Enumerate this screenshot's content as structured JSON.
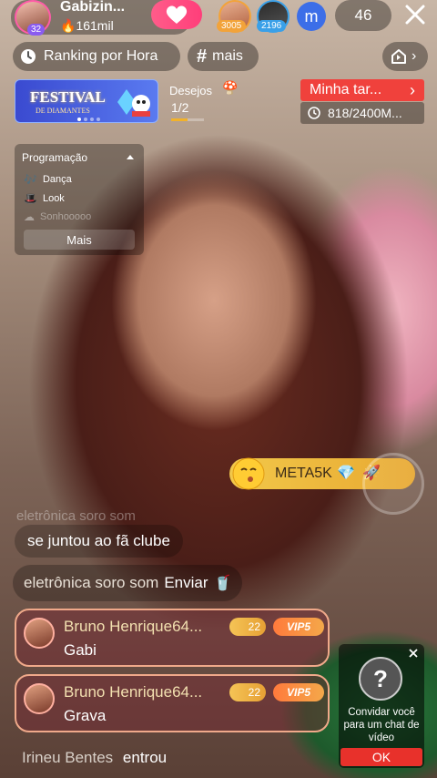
{
  "header": {
    "streamer_name": "Gabizin...",
    "level": "32",
    "likes": "161mil",
    "viewers": [
      {
        "score": "3005",
        "color": "#f2a33a"
      },
      {
        "score": "2196",
        "color": "#3aa0e8"
      },
      {
        "initial": "m",
        "color": "#3c6ee8"
      }
    ],
    "viewer_count": "46"
  },
  "row2": {
    "ranking": "Ranking por Hora",
    "hashtag": "mais"
  },
  "festival": {
    "title": "FESTIVAL",
    "subtitle": "DE DIAMANTES"
  },
  "desejos": {
    "label": "Desejos",
    "progress": "1/2",
    "fraction": 0.5
  },
  "task": {
    "label": "Minha tar...",
    "progress": "818/2400M..."
  },
  "program": {
    "title": "Programação",
    "items": [
      "Dança",
      "Look",
      "Sonhooooo"
    ],
    "more": "Mais"
  },
  "meta": {
    "label": "META5K"
  },
  "chat": {
    "ghost": "eletrônica soro som",
    "joined": "se juntou ao fã clube",
    "send_user": "eletrônica soro som",
    "send_action": "Enviar"
  },
  "messages": [
    {
      "name": "Bruno Henrique64...",
      "level": "22",
      "vip": "VIP5",
      "text": "Gabi"
    },
    {
      "name": "Bruno Henrique64...",
      "level": "22",
      "vip": "VIP5",
      "text": "Grava"
    }
  ],
  "entered": {
    "user": "Irineu Bentes",
    "action": "entrou"
  },
  "invite": {
    "text": "Convidar você para um chat de vídeo",
    "ok": "OK"
  }
}
